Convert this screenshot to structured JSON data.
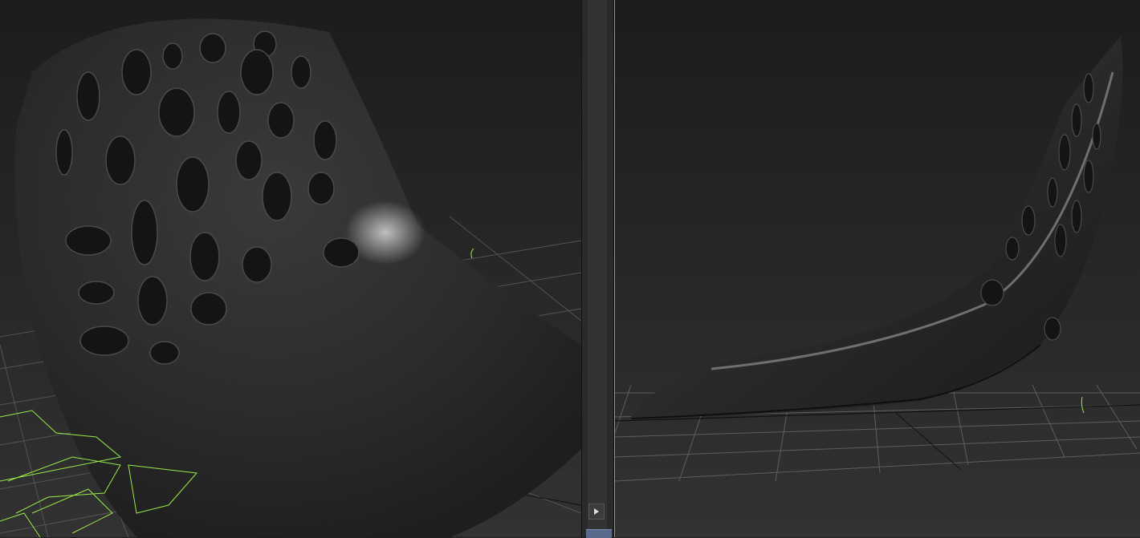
{
  "viewports": {
    "left": {
      "label": ""
    },
    "right": {
      "label": ""
    }
  },
  "colors": {
    "active_border": "#b8962e",
    "grid": "#6a6a6a",
    "selection_wire": "#9be84a",
    "object_surface": "#2b2b2b"
  },
  "controls": {
    "play_icon": "play-icon"
  }
}
